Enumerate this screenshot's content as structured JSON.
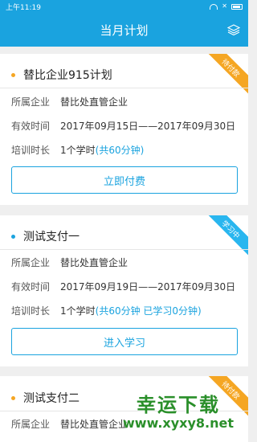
{
  "status_bar": {
    "time": "上午11:19"
  },
  "header": {
    "title": "当月计划"
  },
  "colors": {
    "primary": "#1aa3df",
    "orange": "#f5a623"
  },
  "cards": [
    {
      "title": "替比企业915计划",
      "ribbon": "待付款",
      "dot_color": "#f5a623",
      "ribbon_color": "#f5a623",
      "company_label": "所属企业",
      "company": "替比处直管企业",
      "period_label": "有效时间",
      "period": "2017年09月15日——2017年09月30日",
      "duration_label": "培训时长",
      "duration": "1个学时",
      "duration_extra": "(共60分钟)",
      "button": "立即付费"
    },
    {
      "title": "测试支付一",
      "ribbon": "学习中",
      "dot_color": "#1aa3df",
      "ribbon_color": "#29b6ef",
      "company_label": "所属企业",
      "company": "替比处直管企业",
      "period_label": "有效时间",
      "period": "2017年09月19日——2017年09月30日",
      "duration_label": "培训时长",
      "duration": "1个学时",
      "duration_extra": "(共60分钟  已学习0分钟)",
      "button": "进入学习"
    },
    {
      "title": "测试支付二",
      "ribbon": "待付款",
      "dot_color": "#f5a623",
      "ribbon_color": "#f5a623",
      "company_label": "所属企业",
      "company": "替比处直管企业"
    }
  ],
  "watermark": {
    "main": "幸运下载",
    "sub": "www.xyxy8.net"
  }
}
